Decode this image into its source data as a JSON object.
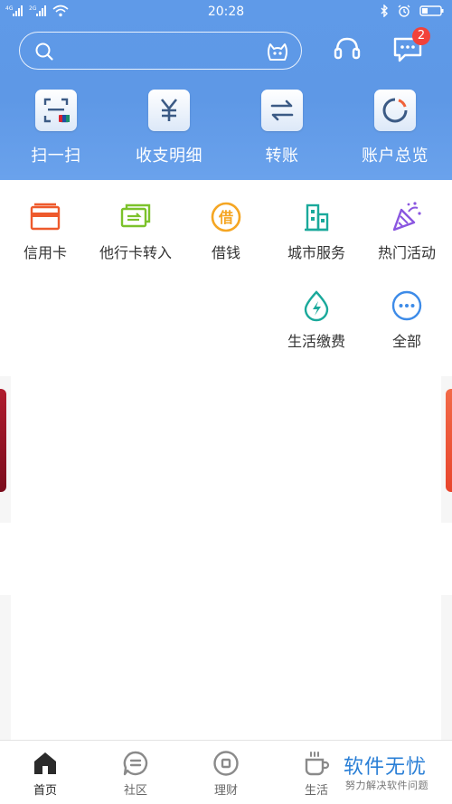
{
  "status_bar": {
    "time": "20:28",
    "signal_labels": [
      "4G",
      "2G"
    ]
  },
  "header": {
    "search": {
      "placeholder": ""
    },
    "message_badge": "2",
    "colors": {
      "gradient_top": "#5f9ae8",
      "gradient_bottom": "#6aa2ec"
    }
  },
  "quick_actions": [
    {
      "label": "扫一扫",
      "icon": "scan-icon"
    },
    {
      "label": "收支明细",
      "icon": "yuan-icon"
    },
    {
      "label": "转账",
      "icon": "transfer-icon"
    },
    {
      "label": "账户总览",
      "icon": "account-overview-icon"
    }
  ],
  "services": [
    {
      "label": "信用卡",
      "icon": "credit-card-icon",
      "color": "#ee5a2c"
    },
    {
      "label": "他行卡转入",
      "icon": "other-bank-transfer-icon",
      "color": "#7cc22b"
    },
    {
      "label": "借钱",
      "icon": "borrow-icon",
      "color": "#f5a623"
    },
    {
      "label": "城市服务",
      "icon": "city-service-icon",
      "color": "#1aa99b"
    },
    {
      "label": "热门活动",
      "icon": "party-popper-icon",
      "color": "#8a56e0"
    },
    {
      "label": "生活缴费",
      "icon": "utility-payment-icon",
      "color": "#1aa99b"
    },
    {
      "label": "全部",
      "icon": "more-icon",
      "color": "#3d8be8"
    }
  ],
  "tabs": [
    {
      "label": "首页",
      "icon": "home-icon",
      "active": true
    },
    {
      "label": "社区",
      "icon": "community-icon",
      "active": false
    },
    {
      "label": "理财",
      "icon": "finance-icon",
      "active": false
    },
    {
      "label": "生活",
      "icon": "life-cup-icon",
      "active": false
    }
  ],
  "watermark": {
    "title": "软件无忧",
    "subtitle": "努力解决软件问题"
  }
}
